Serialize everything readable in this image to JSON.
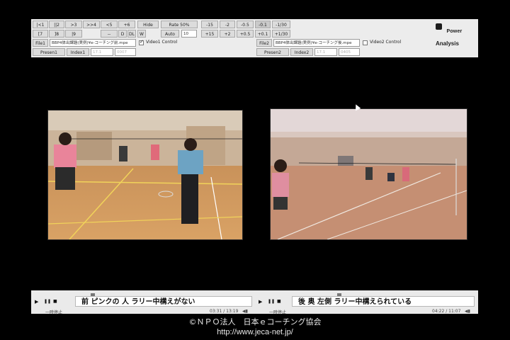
{
  "controls": {
    "row1": {
      "b1": "|<1",
      "b2": "||2",
      "b3": ">3",
      "b4": ">>4",
      "b5": "<5",
      "b6": "+6",
      "hide": "Hide",
      "rate_label": "Rate 50%",
      "m15": "-15",
      "m2": "-2",
      "m05": "-0.5",
      "m01": "-0.1",
      "m130": "-1/30"
    },
    "row2": {
      "b7": "[7",
      "b8": "]8",
      "b9": "|9",
      "dash": "--",
      "d": "D",
      "dd": "DL",
      "w": "W",
      "auto": "Auto",
      "auto_value": "10",
      "p15": "+15",
      "p2": "+2",
      "p05": "+0.5",
      "p01": "+0.1",
      "p130": "+1/30"
    },
    "row3": {
      "file1": "File1",
      "file1_path": "BBP4体出課題(実例)¥e-コーチング前.mpe",
      "video1_control": "Video1 Control",
      "file2": "File2",
      "file2_path": "BBP4体出課題(実例)¥e-コーチング後.mpe",
      "video2_control": "Video2 Control"
    },
    "row4": {
      "presen1": "Presen1",
      "index1": "Index1",
      "idx1_a": "17.1",
      "idx1_b": "0007",
      "presen2": "Presen2",
      "index2": "Index2",
      "idx2_a": "17.1",
      "idx2_b": "0405"
    },
    "logo_line1": "Power",
    "logo_line2": "Analysis"
  },
  "player1": {
    "play": "▶",
    "pause": "❚❚",
    "stop": "■",
    "subtitle": "前 ピンクの 人  ラリー中構えがない",
    "status": "一時停止",
    "time": "03:31 / 13:19"
  },
  "player2": {
    "play": "▶",
    "pause": "❚❚",
    "stop": "■",
    "subtitle": "後 奥 左側  ラリー中構えられている",
    "status": "一時停止",
    "time": "04:22 / 11:07"
  },
  "footer": {
    "copyright": "©ＮＰＯ法人　日本ｅコーチング協会",
    "url": "http://www.jeca-net.jp/"
  }
}
